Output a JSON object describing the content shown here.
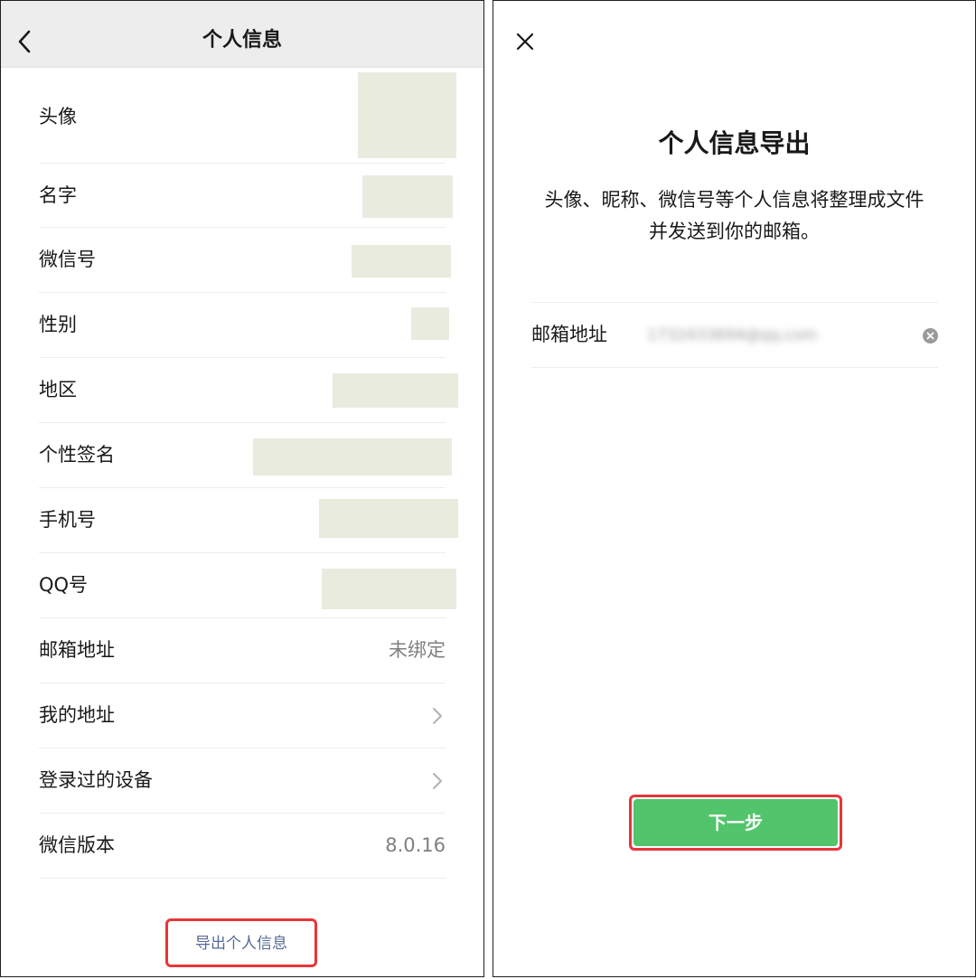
{
  "profile": {
    "title": "个人信息",
    "rows": [
      {
        "label": "头像"
      },
      {
        "label": "名字"
      },
      {
        "label": "微信号"
      },
      {
        "label": "性别"
      },
      {
        "label": "地区"
      },
      {
        "label": "个性签名"
      },
      {
        "label": "手机号"
      },
      {
        "label": "QQ号"
      },
      {
        "label": "邮箱地址",
        "value": "未绑定"
      },
      {
        "label": "我的地址"
      },
      {
        "label": "登录过的设备"
      },
      {
        "label": "微信版本",
        "value": "8.0.16"
      }
    ],
    "export_link": "导出个人信息"
  },
  "export": {
    "title": "个人信息导出",
    "description_line1": "头像、昵称、微信号等个人信息将整理成文件",
    "description_line2": "并发送到你的邮箱。",
    "email_label": "邮箱地址",
    "email_value": "1732433694@qq.com",
    "next_button": "下一步"
  },
  "colors": {
    "accent_green": "#52c46b",
    "highlight_red": "#e8353a",
    "link_blue": "#576b95",
    "header_gray": "#ededed"
  },
  "icons": {
    "back": "back-arrow-icon",
    "close": "close-icon",
    "clear": "clear-input-icon",
    "chevron": "chevron-right-icon"
  }
}
